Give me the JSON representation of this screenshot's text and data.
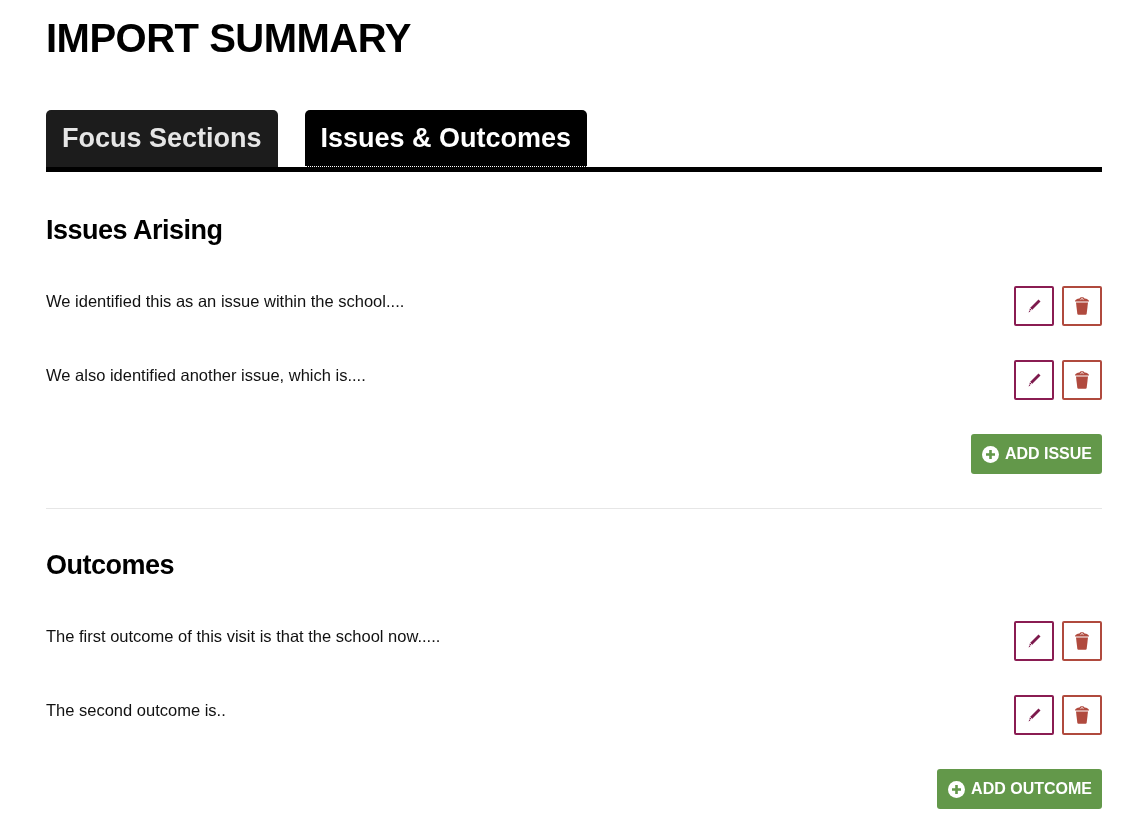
{
  "page_title": "IMPORT SUMMARY",
  "tabs": [
    {
      "label": "Focus Sections",
      "selected": false
    },
    {
      "label": "Issues & Outcomes",
      "selected": true
    }
  ],
  "sections": [
    {
      "heading": "Issues Arising",
      "items": [
        {
          "text": "We identified this as an issue within the school...."
        },
        {
          "text": "We also identified another issue, which is...."
        }
      ],
      "add_button": "ADD ISSUE"
    },
    {
      "heading": "Outcomes",
      "items": [
        {
          "text": "The first outcome of this visit is that the school now....."
        },
        {
          "text": "The second outcome is.."
        }
      ],
      "add_button": "ADD OUTCOME"
    }
  ]
}
